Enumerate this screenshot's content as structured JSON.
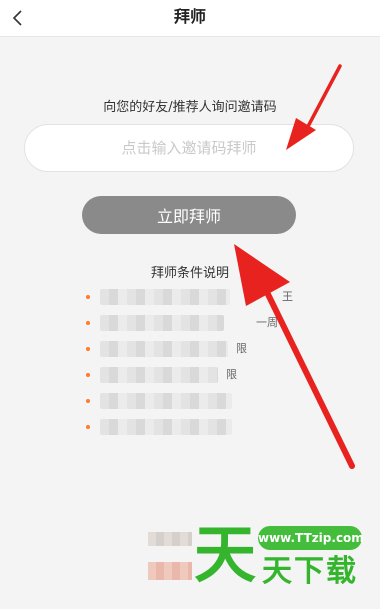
{
  "nav": {
    "title": "拜师",
    "back_icon": "chevron-left-icon"
  },
  "invite": {
    "prompt": "向您的好友/推荐人询问邀请码",
    "input_placeholder": "点击输入邀请码拜师",
    "input_value": ""
  },
  "submit_label": "立即拜师",
  "rules": {
    "title": "拜师条件说明",
    "items": [
      {
        "fragment": "王"
      },
      {
        "fragment": "一周"
      },
      {
        "fragment": "限"
      },
      {
        "fragment": "限"
      },
      {
        "fragment": ""
      },
      {
        "fragment": ""
      }
    ]
  },
  "watermark": {
    "site": "www.TTzip.com",
    "big_char": "天",
    "text": "天下载"
  },
  "colors": {
    "accent_bullet": "#ff7a2a",
    "button_bg": "#8a8a8a",
    "arrow": "#e8231f",
    "watermark_green": "#35b52e"
  }
}
